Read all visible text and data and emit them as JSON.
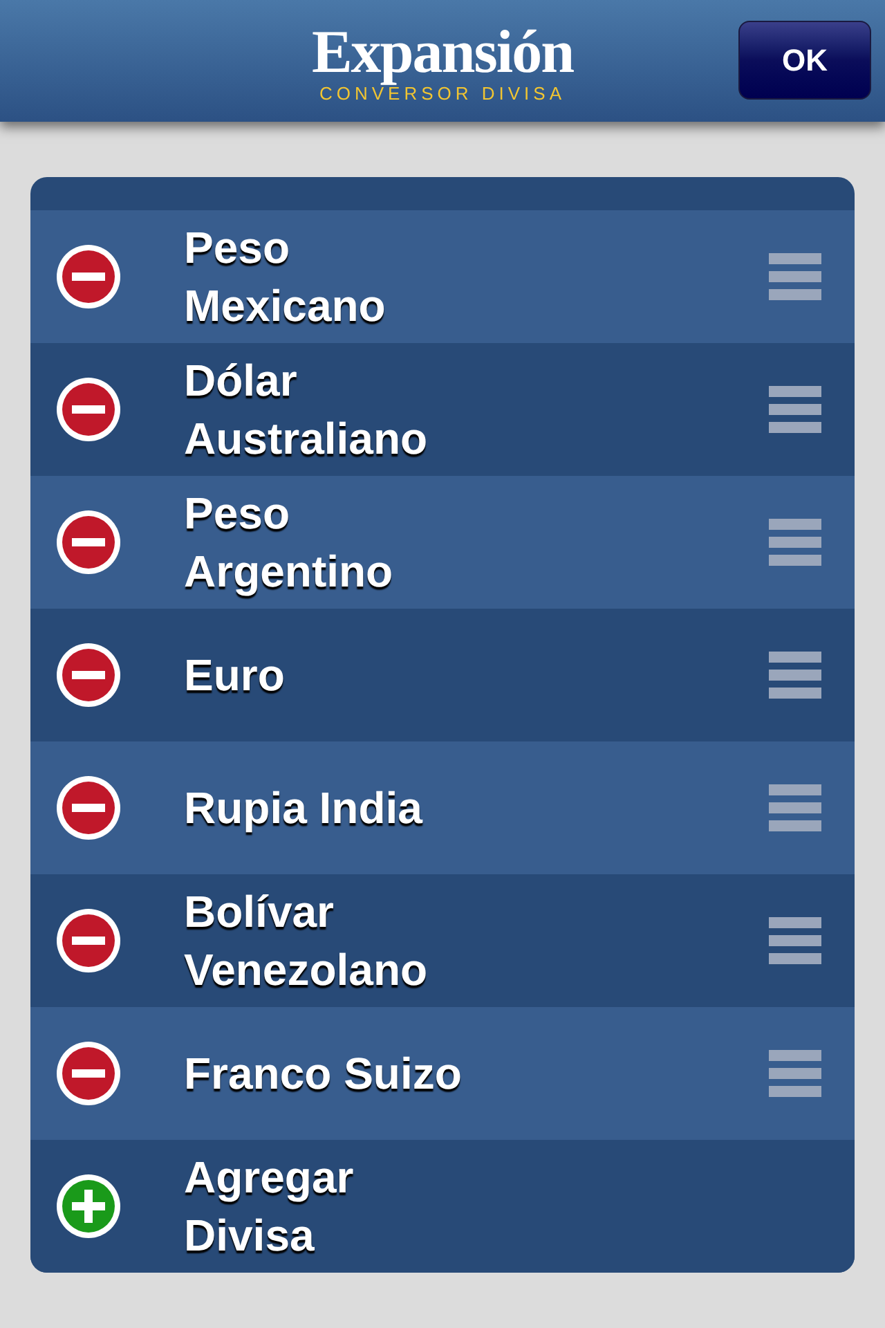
{
  "header": {
    "logo": "Expansión",
    "subtitle": "CONVERSOR DIVISA",
    "ok_button": "OK"
  },
  "rows": [
    {
      "kind": "currency",
      "name": "Peso Mexicano"
    },
    {
      "kind": "currency",
      "name": "Dólar Australiano"
    },
    {
      "kind": "currency",
      "name": "Peso Argentino"
    },
    {
      "kind": "currency",
      "name": "Euro"
    },
    {
      "kind": "currency",
      "name": "Rupia India"
    },
    {
      "kind": "currency",
      "name": "Bolívar Venezolano"
    },
    {
      "kind": "currency",
      "name": "Franco Suizo"
    },
    {
      "kind": "add",
      "name": "Agregar Divisa"
    }
  ]
}
